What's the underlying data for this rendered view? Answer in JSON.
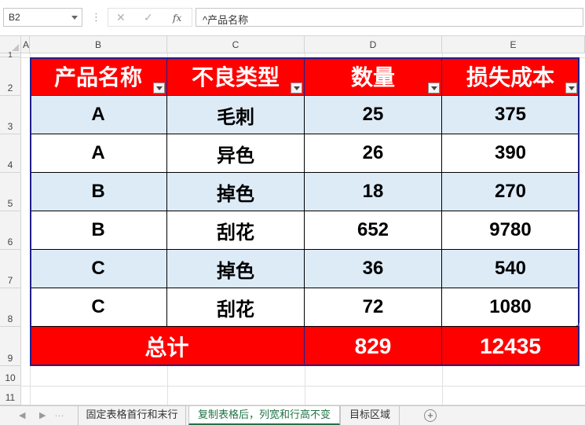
{
  "formula_bar": {
    "name_box": "B2",
    "separator": "⋮",
    "cancel_icon": "✕",
    "confirm_icon": "✓",
    "fx_label": "fx",
    "formula_text": "^产品名称"
  },
  "columns": [
    "A",
    "B",
    "C",
    "D",
    "E"
  ],
  "rows": [
    "1",
    "2",
    "3",
    "4",
    "5",
    "6",
    "7",
    "8",
    "9",
    "10",
    "11"
  ],
  "table": {
    "headers": [
      "产品名称",
      "不良类型",
      "数量",
      "损失成本"
    ],
    "data": [
      [
        "A",
        "毛刺",
        "25",
        "375"
      ],
      [
        "A",
        "异色",
        "26",
        "390"
      ],
      [
        "B",
        "掉色",
        "18",
        "270"
      ],
      [
        "B",
        "刮花",
        "652",
        "9780"
      ],
      [
        "C",
        "掉色",
        "36",
        "540"
      ],
      [
        "C",
        "刮花",
        "72",
        "1080"
      ]
    ],
    "total_label": "总计",
    "total_qty": "829",
    "total_cost": "12435"
  },
  "sheet_tabs": {
    "prev_icon": "◀",
    "next_icon": "▶",
    "more": "...",
    "tabs": [
      "固定表格首行和末行",
      "复制表格后，列宽和行高不变",
      "目标区域"
    ],
    "active_index": 1,
    "add_icon": "+"
  },
  "colors": {
    "header_fill": "#ff0000",
    "band_fill": "#ddebf7",
    "border": "#1f1f8a",
    "accent_tab": "#217346"
  }
}
